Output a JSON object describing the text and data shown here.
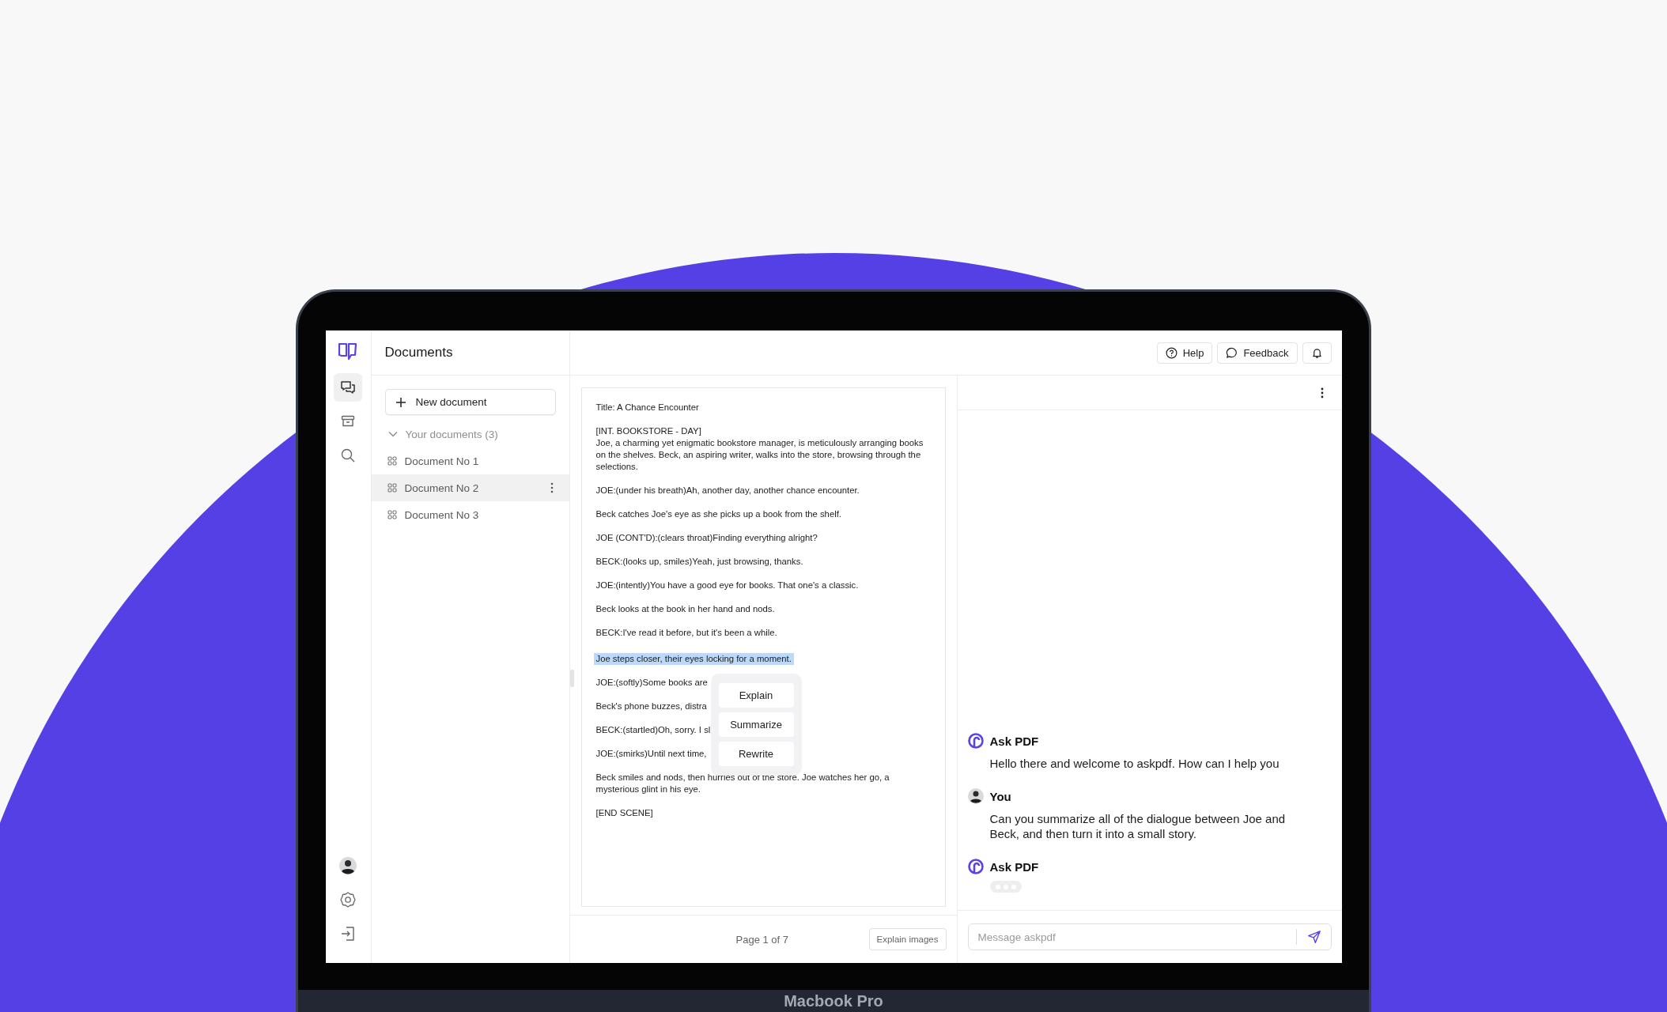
{
  "device": {
    "label": "Macbook Pro"
  },
  "rail": {
    "items": [
      {
        "kind": "chat",
        "selected": true
      },
      {
        "kind": "archive",
        "selected": false
      },
      {
        "kind": "search",
        "selected": false
      }
    ],
    "bottom": [
      {
        "kind": "avatar"
      },
      {
        "kind": "settings"
      },
      {
        "kind": "logout"
      }
    ]
  },
  "sidebar": {
    "title": "Documents",
    "new_button": "New document",
    "section": {
      "label": "Your documents (3)",
      "expanded": true
    },
    "items": [
      {
        "label": "Document No 1",
        "selected": false
      },
      {
        "label": "Document No 2",
        "selected": true
      },
      {
        "label": "Document No 3",
        "selected": false
      }
    ]
  },
  "header": {
    "buttons": [
      {
        "kind": "help",
        "label": "Help"
      },
      {
        "kind": "feedback",
        "label": "Feedback"
      },
      {
        "kind": "bell"
      }
    ]
  },
  "document": {
    "paragraphs": [
      {
        "text": "Title: A Chance Encounter",
        "highlighted": false
      },
      {
        "text": "[INT. BOOKSTORE - DAY]\nJoe, a charming yet enigmatic bookstore manager, is meticulously arranging books on the shelves. Beck, an aspiring writer, walks into the store, browsing through the selections.",
        "highlighted": false
      },
      {
        "text": "JOE:(under his breath)Ah, another day, another chance encounter.",
        "highlighted": false
      },
      {
        "text": "Beck catches Joe's eye as she picks up a book from the shelf.",
        "highlighted": false
      },
      {
        "text": "JOE (CONT'D):(clears throat)Finding everything alright?",
        "highlighted": false
      },
      {
        "text": "BECK:(looks up, smiles)Yeah, just browsing, thanks.",
        "highlighted": false
      },
      {
        "text": "JOE:(intently)You have a good eye for books. That one's a classic.",
        "highlighted": false
      },
      {
        "text": "Beck looks at the book in her hand and nods.",
        "highlighted": false
      },
      {
        "text": "BECK:I've read it before, but it's been a while.",
        "highlighted": false
      },
      {
        "text": "Joe steps closer, their eyes locking for a moment.",
        "highlighted": true
      },
      {
        "text": "JOE:(softly)Some books are",
        "highlighted": false
      },
      {
        "text": "Beck's phone buzzes, distra",
        "highlighted": false
      },
      {
        "text": "BECK:(startled)Oh, sorry. I sl",
        "highlighted": false
      },
      {
        "text": "JOE:(smirks)Until next time,",
        "highlighted": false
      },
      {
        "text": "Beck smiles and nods, then hurries out of the store. Joe watches her go, a mysterious glint in his eye.",
        "highlighted": false
      },
      {
        "text": "[END SCENE]",
        "highlighted": false
      }
    ],
    "popup": {
      "actions": [
        "Explain",
        "Summarize",
        "Rewrite"
      ]
    },
    "page_label": "Page 1 of 7",
    "explain_button": "Explain images"
  },
  "chat": {
    "messages": [
      {
        "kind": "bot",
        "author": "Ask PDF",
        "text": "Hello there and welcome to askpdf. How can I help you",
        "typing": false
      },
      {
        "kind": "user",
        "author": "You",
        "text": "Can you summarize all of the dialogue between Joe and Beck, and then turn it into a small story.",
        "typing": false
      },
      {
        "kind": "bot",
        "author": "Ask PDF",
        "typing": true
      }
    ],
    "input": {
      "placeholder": "Message askpdf"
    }
  }
}
